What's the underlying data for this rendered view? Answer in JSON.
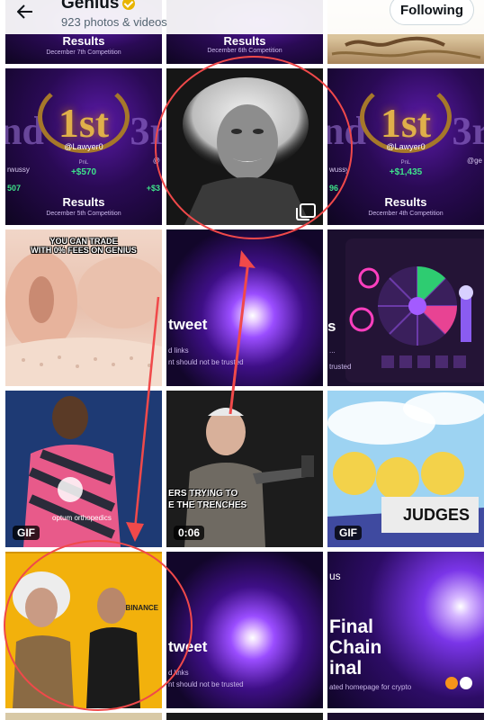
{
  "header": {
    "title": "Genius",
    "subtitle": "923 photos & videos",
    "follow_label": "Following"
  },
  "tiles": {
    "r0c0": {
      "title": "Results",
      "sub": "December 7th Competition"
    },
    "r0c1": {
      "title": "Results",
      "sub": "December 6th Competition"
    },
    "r1c0": {
      "first": "1st",
      "handle": "@Lawyer0",
      "pnl_label": "PnL",
      "amount": "+$570",
      "title": "Results",
      "sub": "December 5th Competition",
      "left_ghost": "nd",
      "right_ghost": "3r",
      "left_handle": "rwussy",
      "left_amount": "507",
      "right_handle": "@",
      "right_amount": "+$3"
    },
    "r1c2": {
      "first": "1st",
      "handle": "@Lawyer0",
      "pnl_label": "PnL",
      "amount": "+$1,435",
      "title": "Results",
      "sub": "December 4th Competition",
      "left_ghost": "nd",
      "right_ghost": "3r",
      "left_handle": "wussy",
      "left_amount": "96",
      "right_handle": "@ge"
    },
    "r2c0": {
      "caption": "YOU CAN TRADE\nWITH 0% FEES ON GENIUS"
    },
    "r2c1": {
      "big": "tweet",
      "line1": "d links",
      "line2": "nt should not be trusted"
    },
    "r2c2": {
      "big": "s",
      "line1": "...",
      "line2": "trusted"
    },
    "r3c0": {
      "badge": "GIF",
      "shirt": "optum orthopedics"
    },
    "r3c1": {
      "badge": "0:06",
      "caption1": "ERS TRYING TO",
      "caption2": "E THE TRENCHES"
    },
    "r3c2": {
      "badge": "GIF",
      "sign": "JUDGES"
    },
    "r4c0": {
      "brand": "BINANCE"
    },
    "r4c1": {
      "big": "tweet",
      "line1": "d links",
      "line2": "nt should not be trusted"
    },
    "r4c2": {
      "big": "Final\nChain\ninal",
      "top": "us",
      "line2": "ated homepage for crypto"
    }
  },
  "colors": {
    "accent_purple": "#5a1aa8",
    "pnl_green": "#3ee28a",
    "annotation_red": "#f0494a",
    "gold": "#e0b04a"
  },
  "icons": [
    "back-arrow-icon",
    "verified-badge-icon",
    "multiple-images-icon"
  ]
}
